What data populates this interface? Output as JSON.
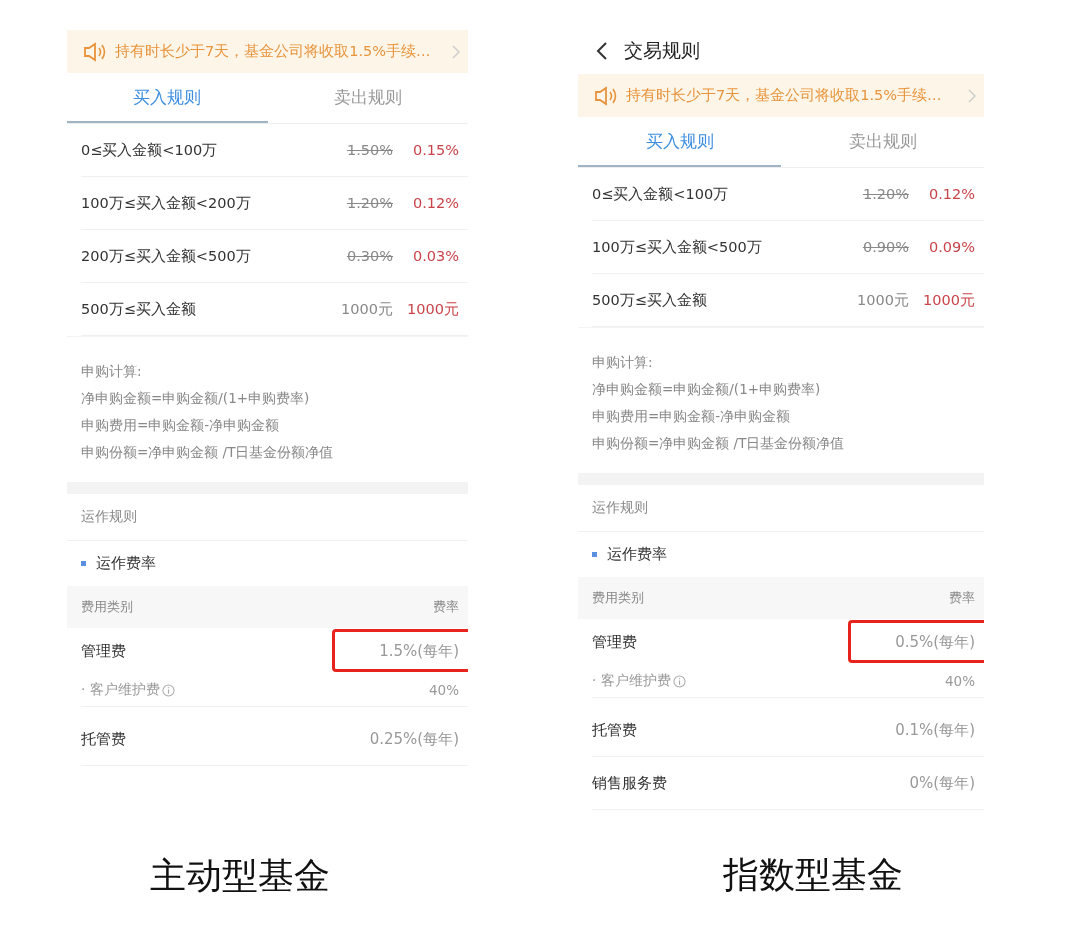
{
  "panels": [
    {
      "notice": "持有时长少于7天，基金公司将收取1.5%手续…",
      "tabs": [
        {
          "label": "买入规则",
          "selected": true
        },
        {
          "label": "卖出规则",
          "selected": false
        }
      ],
      "buy_rules": [
        {
          "range": "0≤买入金额<100万",
          "original": "1.50%",
          "struck": true,
          "discounted": "0.15%"
        },
        {
          "range": "100万≤买入金额<200万",
          "original": "1.20%",
          "struck": true,
          "discounted": "0.12%"
        },
        {
          "range": "200万≤买入金额<500万",
          "original": "0.30%",
          "struck": true,
          "discounted": "0.03%"
        },
        {
          "range": "500万≤买入金额",
          "original": "1000元",
          "struck": false,
          "discounted": "1000元"
        }
      ],
      "calc": {
        "heading": "申购计算:",
        "lines": [
          "净申购金额=申购金额/(1+申购费率)",
          "申购费用=申购金额-净申购金额",
          "申购份额=净申购金额 /T日基金份额净值"
        ]
      },
      "section_title": "运作规则",
      "fee_title": "运作费率",
      "fee_headers": [
        "费用类别",
        "费率"
      ],
      "fee_rows": [
        {
          "kind": "main",
          "name": "管理费",
          "value": "1.5%(每年)",
          "highlighted": true
        },
        {
          "kind": "sub",
          "name": "· 客户维护费",
          "value": "40%",
          "highlighted": false
        },
        {
          "kind": "main",
          "name": "托管费",
          "value": "0.25%(每年)",
          "highlighted": false
        }
      ],
      "caption": "主动型基金"
    },
    {
      "title": "交易规则",
      "notice": "持有时长少于7天，基金公司将收取1.5%手续…",
      "tabs": [
        {
          "label": "买入规则",
          "selected": true
        },
        {
          "label": "卖出规则",
          "selected": false
        }
      ],
      "buy_rules": [
        {
          "range": "0≤买入金额<100万",
          "original": "1.20%",
          "struck": true,
          "discounted": "0.12%"
        },
        {
          "range": "100万≤买入金额<500万",
          "original": "0.90%",
          "struck": true,
          "discounted": "0.09%"
        },
        {
          "range": "500万≤买入金额",
          "original": "1000元",
          "struck": false,
          "discounted": "1000元"
        }
      ],
      "calc": {
        "heading": "申购计算:",
        "lines": [
          "净申购金额=申购金额/(1+申购费率)",
          "申购费用=申购金额-净申购金额",
          "申购份额=净申购金额 /T日基金份额净值"
        ]
      },
      "section_title": "运作规则",
      "fee_title": "运作费率",
      "fee_headers": [
        "费用类别",
        "费率"
      ],
      "fee_rows": [
        {
          "kind": "main",
          "name": "管理费",
          "value": "0.5%(每年)",
          "highlighted": true
        },
        {
          "kind": "sub",
          "name": "· 客户维护费",
          "value": "40%",
          "highlighted": false
        },
        {
          "kind": "main",
          "name": "托管费",
          "value": "0.1%(每年)",
          "highlighted": false
        },
        {
          "kind": "main",
          "name": "销售服务费",
          "value": "0%(每年)",
          "highlighted": false
        }
      ],
      "caption": "指数型基金"
    }
  ]
}
